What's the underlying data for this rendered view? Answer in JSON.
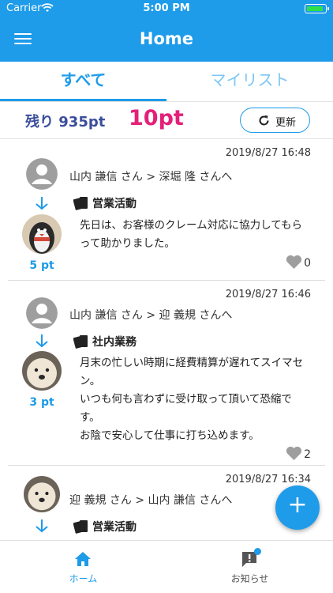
{
  "status_bar": {
    "carrier": "Carrier",
    "time": "5:00 PM"
  },
  "header": {
    "title": "Home"
  },
  "tabs": [
    {
      "label": "すべて",
      "active": true
    },
    {
      "label": "マイリスト",
      "active": false
    }
  ],
  "points": {
    "remaining_label": "残り",
    "remaining_value": "935pt",
    "current": "10pt",
    "refresh_label": "更新"
  },
  "posts": [
    {
      "date": "2019/8/27 16:48",
      "names": "山内 謙信 さん > 深堀 隆 さんへ",
      "category": "営業活動",
      "message": "先日は、お客様のクレーム対応に協力してもらって助かりました。",
      "points": "5 pt",
      "likes": "0"
    },
    {
      "date": "2019/8/27 16:46",
      "names": "山内 謙信 さん > 迎 義規 さんへ",
      "category": "社内業務",
      "message": "月末の忙しい時期に経費精算が遅れてスイマセン。\nいつも何も言わずに受け取って頂いて恐縮です。\nお陰で安心して仕事に打ち込めます。",
      "points": "3 pt",
      "likes": "2"
    },
    {
      "date": "2019/8/27 16:34",
      "names": "迎 義規 さん > 山内 謙信 さんへ",
      "category": "営業活動"
    }
  ],
  "fab": {
    "label": "+"
  },
  "bottom_nav": [
    {
      "label": "ホーム",
      "active": true
    },
    {
      "label": "お知らせ",
      "active": false
    }
  ],
  "colors": {
    "primary": "#1e9be9",
    "points_remaining": "#3b4e9c",
    "points_current": "#e3207a"
  }
}
